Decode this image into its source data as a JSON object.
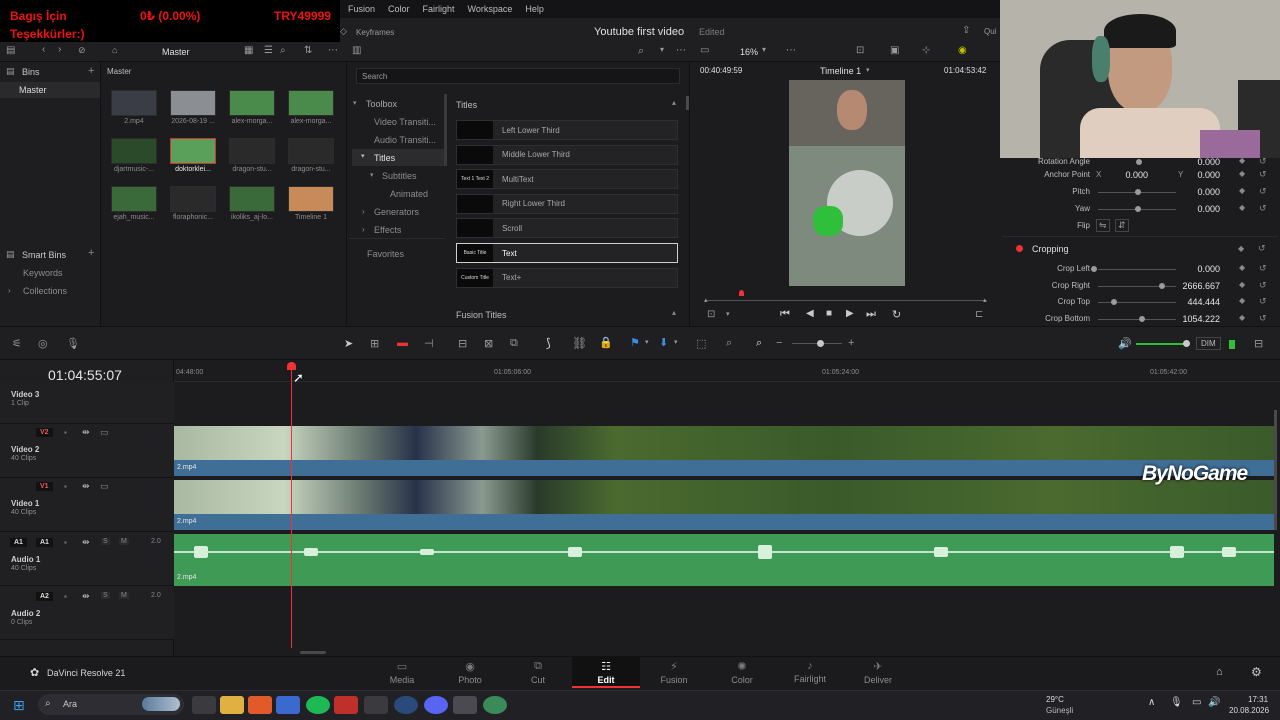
{
  "stream_overlay": {
    "line1": "Bagış İçin",
    "amount": "0₺ (0.00%)",
    "goal": "TRY49999",
    "line2": "Teşekkürler:)"
  },
  "menu": {
    "items": [
      "Fusion",
      "Color",
      "Fairlight",
      "Workspace",
      "Help"
    ]
  },
  "project": {
    "name": "Youtube first video",
    "status": "Edited",
    "quick": "Qui"
  },
  "toolbar": {
    "keyframes": "Keyframes",
    "master": "Master",
    "zoom": "16%",
    "timeline_name": "Timeline 1",
    "tc_left": "00:40:49:59",
    "tc_right": "01:04:53:42"
  },
  "media_pool": {
    "bins_label": "Bins",
    "master_bin": "Master",
    "breadcrumb": "Master",
    "smart_bins": "Smart Bins",
    "keywords": "Keywords",
    "collections": "Collections",
    "clips": [
      {
        "name": "2.mp4",
        "color": "#3a3d45"
      },
      {
        "name": "2026-08-19 ...",
        "color": "#8b8f94"
      },
      {
        "name": "alex-morga...",
        "color": "#4a8a4a"
      },
      {
        "name": "alex-morga...",
        "color": "#4a8a4a"
      },
      {
        "name": "djartmusic-...",
        "color": "#2a4a2a"
      },
      {
        "name": "doktorklei...",
        "color": "#5aa05a"
      },
      {
        "name": "dragon-stu...",
        "color": "#2a2a2a"
      },
      {
        "name": "dragon-stu...",
        "color": "#2a2a2a"
      },
      {
        "name": "ejah_music...",
        "color": "#3a6a3a"
      },
      {
        "name": "floraphonic...",
        "color": "#2a2a2a"
      },
      {
        "name": "ikoliks_aj-lo...",
        "color": "#3a6a3a"
      },
      {
        "name": "Timeline 1",
        "color": "#c98a5a"
      }
    ]
  },
  "effects": {
    "search_placeholder": "Search",
    "toolbox": "Toolbox",
    "video_transitions": "Video Transiti...",
    "audio_transitions": "Audio Transiti...",
    "titles": "Titles",
    "subtitles": "Subtitles",
    "animated": "Animated",
    "generators": "Generators",
    "effects": "Effects",
    "favorites": "Favorites",
    "titles_header": "Titles",
    "fusion_titles": "Fusion Titles",
    "title_items": [
      {
        "thumb": "",
        "name": "Left Lower Third"
      },
      {
        "thumb": "",
        "name": "Middle Lower Third"
      },
      {
        "thumb": "Text 1 Text 2",
        "name": "MultiText"
      },
      {
        "thumb": "",
        "name": "Right Lower Third"
      },
      {
        "thumb": "",
        "name": "Scroll"
      },
      {
        "thumb": "Basic Title",
        "name": "Text"
      },
      {
        "thumb": "Custom Title",
        "name": "Text+"
      }
    ]
  },
  "inspector": {
    "rotation_angle": "Rotation Angle",
    "rotation_val": "0.000",
    "anchor_point": "Anchor Point",
    "anchor_x_lbl": "X",
    "anchor_x": "0.000",
    "anchor_y_lbl": "Y",
    "anchor_y": "0.000",
    "pitch": "Pitch",
    "pitch_val": "0.000",
    "yaw": "Yaw",
    "yaw_val": "0.000",
    "flip": "Flip",
    "cropping": "Cropping",
    "crop_left": "Crop Left",
    "crop_left_val": "0.000",
    "crop_right": "Crop Right",
    "crop_right_val": "2666.667",
    "crop_top": "Crop Top",
    "crop_top_val": "444.444",
    "crop_bottom": "Crop Bottom",
    "crop_bottom_val": "1054.222"
  },
  "timeline": {
    "timecode": "01:04:55:07",
    "ruler": [
      "04:48:00",
      "01:05:06:00",
      "01:05:24:00",
      "01:05:42:00"
    ],
    "dim": "DIM",
    "tracks": [
      {
        "name": "Video 3",
        "clips": "1 Clip"
      },
      {
        "tag": "V2",
        "name": "Video 2",
        "clips": "40 Clips",
        "file": "2.mp4"
      },
      {
        "tag": "V1",
        "name": "Video 1",
        "clips": "40 Clips",
        "file": "2.mp4"
      },
      {
        "tag": "A1",
        "name": "Audio 1",
        "clips": "40 Clips",
        "file": "2.mp4",
        "level": "2.0"
      },
      {
        "tag": "A2",
        "name": "Audio 2",
        "clips": "0 Clips",
        "level": "2.0"
      }
    ],
    "watermark": "ByNoGame",
    "solo": "S",
    "mute": "M"
  },
  "pages": {
    "app": "DaVinci Resolve 21",
    "tabs": [
      "Media",
      "Photo",
      "Cut",
      "Edit",
      "Fusion",
      "Color",
      "Fairlight",
      "Deliver"
    ],
    "active": "Edit"
  },
  "taskbar": {
    "search": "Ara",
    "weather_temp": "29°C",
    "weather_desc": "Güneşli",
    "time": "17:31",
    "date": "20.08.2026"
  }
}
